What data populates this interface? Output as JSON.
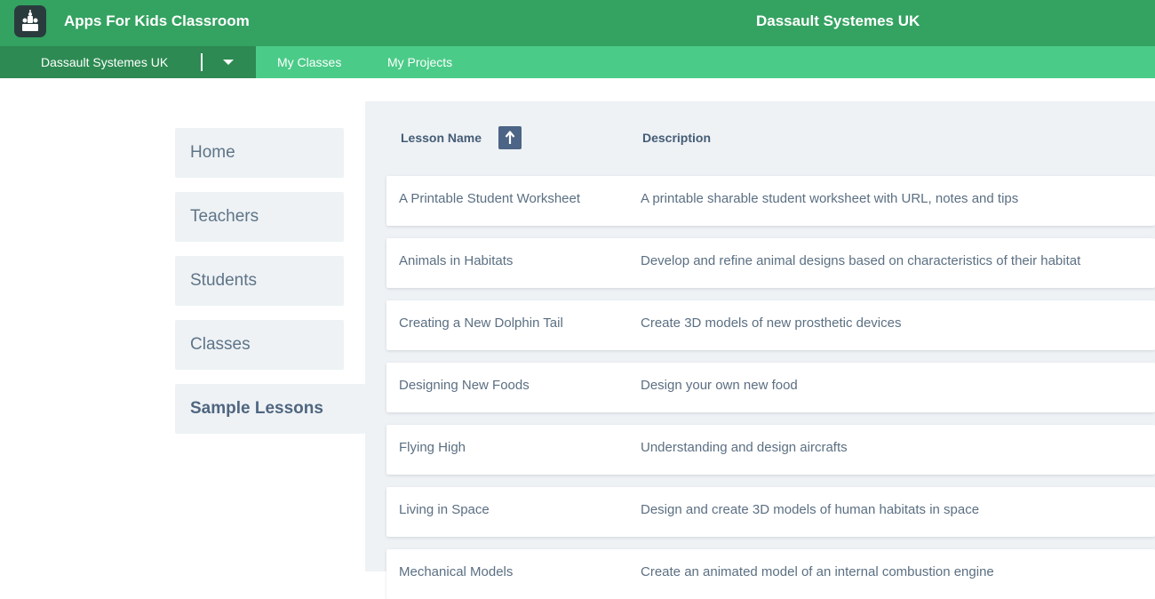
{
  "header": {
    "app_title": "Apps For Kids Classroom",
    "org_title": "Dassault Systemes UK",
    "logo_icon": "classroom-logo-icon",
    "color": "#34a261"
  },
  "subnav": {
    "org_selector": "Dassault Systemes UK",
    "links": [
      "My Classes",
      "My Projects"
    ],
    "color": "#4bcb88"
  },
  "sidebar": {
    "items": [
      {
        "label": "Home"
      },
      {
        "label": "Teachers"
      },
      {
        "label": "Students"
      },
      {
        "label": "Classes"
      },
      {
        "label": "Sample Lessons",
        "active": true
      }
    ]
  },
  "table": {
    "headers": {
      "name": "Lesson Name",
      "description": "Description"
    },
    "sort_icon": "sort-ascending-icon",
    "rows": [
      {
        "name": "A Printable Student Worksheet",
        "description": "A printable sharable student worksheet with URL, notes and tips"
      },
      {
        "name": "Animals in Habitats",
        "description": "Develop and refine animal designs based on characteristics of their habitat"
      },
      {
        "name": "Creating a New Dolphin Tail",
        "description": "Create 3D models of new prosthetic devices"
      },
      {
        "name": "Designing New Foods",
        "description": "Design your own new food"
      },
      {
        "name": "Flying High",
        "description": "Understanding and design aircrafts"
      },
      {
        "name": "Living in Space",
        "description": "Design and create 3D models of human habitats in space"
      },
      {
        "name": "Mechanical Models",
        "description": "Create an animated model of an internal combustion engine"
      }
    ]
  }
}
